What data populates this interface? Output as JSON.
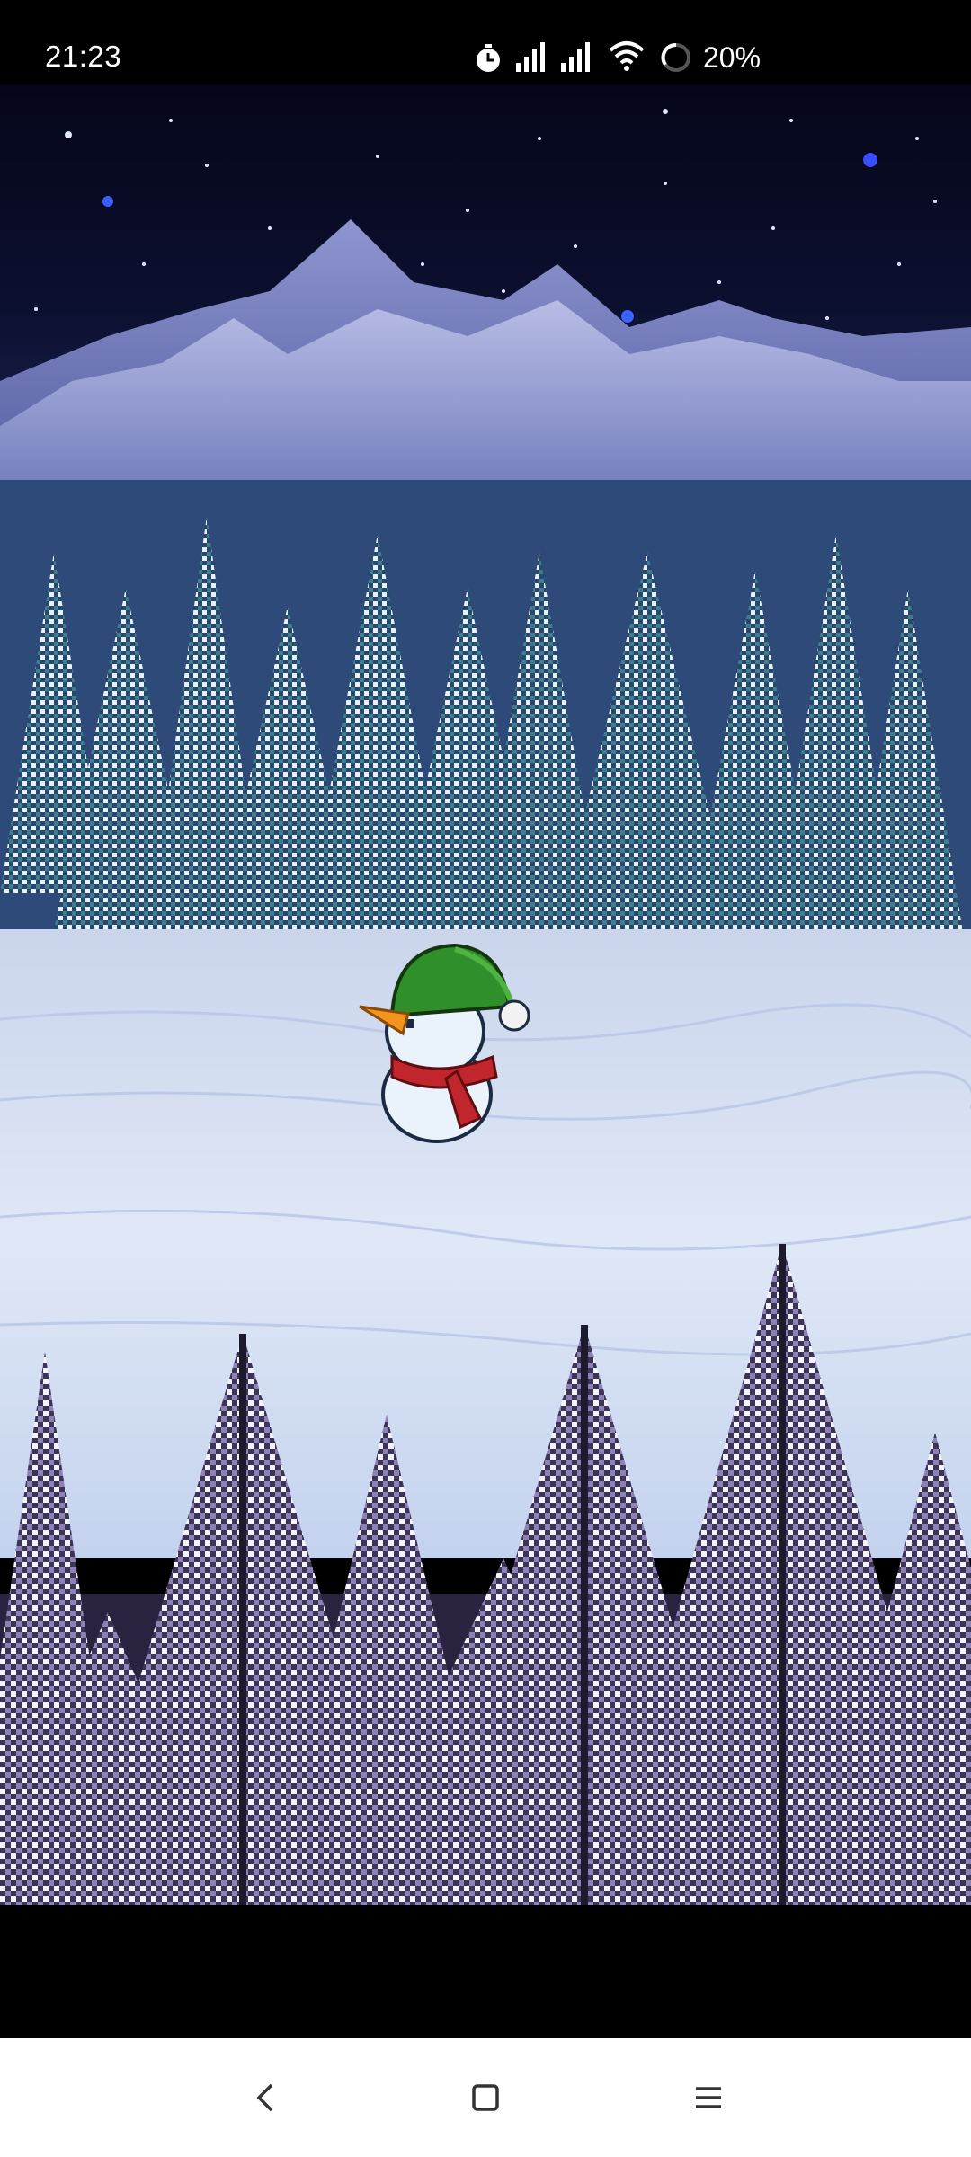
{
  "status_bar": {
    "time": "21:23",
    "battery_percent": "20%",
    "icons": [
      "alarm-icon",
      "signal-icon",
      "signal-icon",
      "wifi-icon",
      "battery-ring-icon"
    ]
  },
  "game": {
    "scene": "snowy-forest-night",
    "character": "snowman",
    "colors": {
      "sky": "#0a0b22",
      "snow": "#dfe8f6",
      "hat": "#2f8f2a",
      "scarf": "#c0262b",
      "nose": "#f2951c"
    }
  },
  "nav_bar": {
    "buttons": [
      "back-icon",
      "home-icon",
      "menu-icon"
    ]
  }
}
